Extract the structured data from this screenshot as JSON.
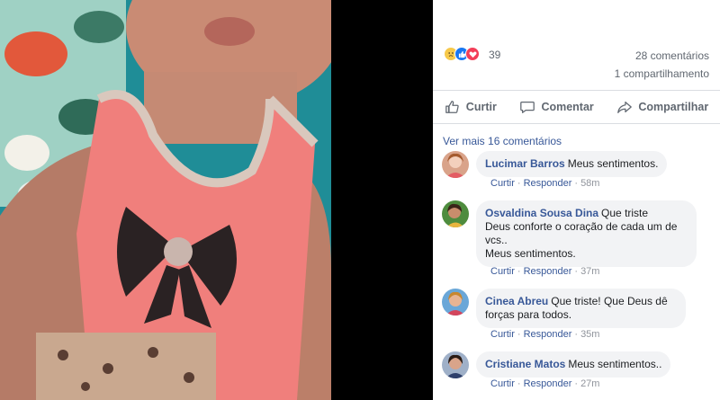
{
  "post": {
    "reaction_icons": [
      "sad-face-icon",
      "like-icon",
      "love-icon"
    ],
    "reaction_count": "39",
    "comments_count": "28 comentários",
    "shares_count": "1 compartilhamento"
  },
  "actions": {
    "like": "Curtir",
    "comment": "Comentar",
    "share": "Compartilhar"
  },
  "view_more": "Ver mais 16 comentários",
  "comment_actions": {
    "like": "Curtir",
    "reply": "Responder",
    "sep": "·"
  },
  "comments": [
    {
      "author": "Lucimar Barros",
      "text": "Meus sentimentos.",
      "time": "58m"
    },
    {
      "author": "Osvaldina Sousa Dina",
      "text_line1": "Que triste",
      "text_line2": "Deus conforte o coração de cada um de",
      "text_line3": "vcs..",
      "text_line4": "Meus sentimentos.",
      "time": "37m"
    },
    {
      "author": "Cinea Abreu",
      "text_line1": "Que triste! Que Deus dê",
      "text_line2": "forças para todos.",
      "time": "35m"
    },
    {
      "author": "Cristiane Matos",
      "text": "Meus sentimentos..",
      "time": "27m"
    }
  ],
  "colors": {
    "link": "#385898",
    "meta": "#90949c",
    "bubble": "#f2f3f5",
    "like_blue": "#1877f2",
    "love_red": "#f33e58"
  }
}
